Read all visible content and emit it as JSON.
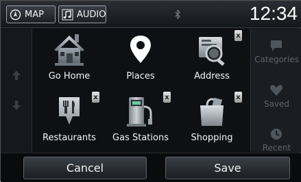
{
  "topbar": {
    "map_label": "MAP",
    "audio_label": "AUDIO",
    "clock": "12:34"
  },
  "grid": [
    {
      "label": "Go Home",
      "icon": "house-icon",
      "deletable": false
    },
    {
      "label": "Places",
      "icon": "map-pin-icon",
      "deletable": false
    },
    {
      "label": "Address",
      "icon": "address-book-icon",
      "deletable": true
    },
    {
      "label": "Restaurants",
      "icon": "restaurant-icon",
      "deletable": true
    },
    {
      "label": "Gas Stations",
      "icon": "gas-pump-icon",
      "deletable": true
    },
    {
      "label": "Shopping",
      "icon": "shopping-bag-icon",
      "deletable": true
    }
  ],
  "badge_text": "x",
  "sidebar": {
    "items": [
      {
        "label": "Categories",
        "icon": "flag-icon"
      },
      {
        "label": "Saved",
        "icon": "heart-icon"
      },
      {
        "label": "Recent",
        "icon": "clock-icon"
      }
    ]
  },
  "bottom": {
    "cancel_label": "Cancel",
    "save_label": "Save"
  },
  "colors": {
    "background": "#0e1013",
    "text": "#f4f4f4",
    "disabled_text": "#5f656c"
  }
}
